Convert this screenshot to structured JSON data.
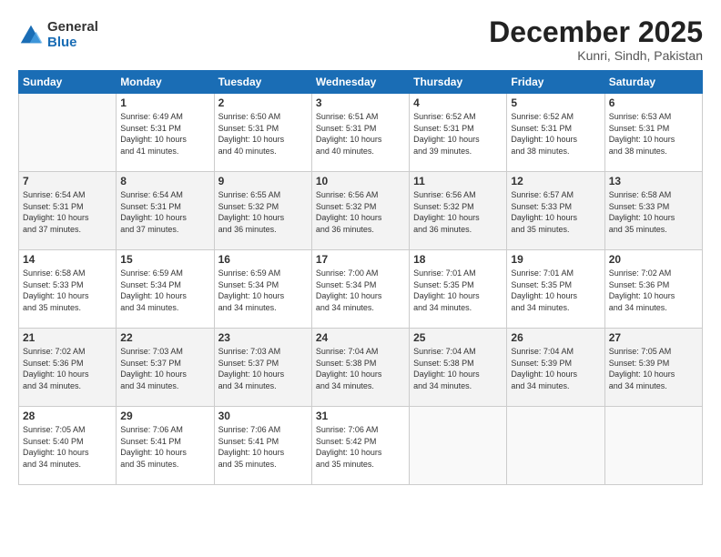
{
  "logo": {
    "general": "General",
    "blue": "Blue"
  },
  "title": "December 2025",
  "subtitle": "Kunri, Sindh, Pakistan",
  "days": [
    "Sunday",
    "Monday",
    "Tuesday",
    "Wednesday",
    "Thursday",
    "Friday",
    "Saturday"
  ],
  "weeks": [
    [
      {
        "day": "",
        "content": ""
      },
      {
        "day": "1",
        "content": "Sunrise: 6:49 AM\nSunset: 5:31 PM\nDaylight: 10 hours\nand 41 minutes."
      },
      {
        "day": "2",
        "content": "Sunrise: 6:50 AM\nSunset: 5:31 PM\nDaylight: 10 hours\nand 40 minutes."
      },
      {
        "day": "3",
        "content": "Sunrise: 6:51 AM\nSunset: 5:31 PM\nDaylight: 10 hours\nand 40 minutes."
      },
      {
        "day": "4",
        "content": "Sunrise: 6:52 AM\nSunset: 5:31 PM\nDaylight: 10 hours\nand 39 minutes."
      },
      {
        "day": "5",
        "content": "Sunrise: 6:52 AM\nSunset: 5:31 PM\nDaylight: 10 hours\nand 38 minutes."
      },
      {
        "day": "6",
        "content": "Sunrise: 6:53 AM\nSunset: 5:31 PM\nDaylight: 10 hours\nand 38 minutes."
      }
    ],
    [
      {
        "day": "7",
        "content": "Sunrise: 6:54 AM\nSunset: 5:31 PM\nDaylight: 10 hours\nand 37 minutes."
      },
      {
        "day": "8",
        "content": "Sunrise: 6:54 AM\nSunset: 5:31 PM\nDaylight: 10 hours\nand 37 minutes."
      },
      {
        "day": "9",
        "content": "Sunrise: 6:55 AM\nSunset: 5:32 PM\nDaylight: 10 hours\nand 36 minutes."
      },
      {
        "day": "10",
        "content": "Sunrise: 6:56 AM\nSunset: 5:32 PM\nDaylight: 10 hours\nand 36 minutes."
      },
      {
        "day": "11",
        "content": "Sunrise: 6:56 AM\nSunset: 5:32 PM\nDaylight: 10 hours\nand 36 minutes."
      },
      {
        "day": "12",
        "content": "Sunrise: 6:57 AM\nSunset: 5:33 PM\nDaylight: 10 hours\nand 35 minutes."
      },
      {
        "day": "13",
        "content": "Sunrise: 6:58 AM\nSunset: 5:33 PM\nDaylight: 10 hours\nand 35 minutes."
      }
    ],
    [
      {
        "day": "14",
        "content": "Sunrise: 6:58 AM\nSunset: 5:33 PM\nDaylight: 10 hours\nand 35 minutes."
      },
      {
        "day": "15",
        "content": "Sunrise: 6:59 AM\nSunset: 5:34 PM\nDaylight: 10 hours\nand 34 minutes."
      },
      {
        "day": "16",
        "content": "Sunrise: 6:59 AM\nSunset: 5:34 PM\nDaylight: 10 hours\nand 34 minutes."
      },
      {
        "day": "17",
        "content": "Sunrise: 7:00 AM\nSunset: 5:34 PM\nDaylight: 10 hours\nand 34 minutes."
      },
      {
        "day": "18",
        "content": "Sunrise: 7:01 AM\nSunset: 5:35 PM\nDaylight: 10 hours\nand 34 minutes."
      },
      {
        "day": "19",
        "content": "Sunrise: 7:01 AM\nSunset: 5:35 PM\nDaylight: 10 hours\nand 34 minutes."
      },
      {
        "day": "20",
        "content": "Sunrise: 7:02 AM\nSunset: 5:36 PM\nDaylight: 10 hours\nand 34 minutes."
      }
    ],
    [
      {
        "day": "21",
        "content": "Sunrise: 7:02 AM\nSunset: 5:36 PM\nDaylight: 10 hours\nand 34 minutes."
      },
      {
        "day": "22",
        "content": "Sunrise: 7:03 AM\nSunset: 5:37 PM\nDaylight: 10 hours\nand 34 minutes."
      },
      {
        "day": "23",
        "content": "Sunrise: 7:03 AM\nSunset: 5:37 PM\nDaylight: 10 hours\nand 34 minutes."
      },
      {
        "day": "24",
        "content": "Sunrise: 7:04 AM\nSunset: 5:38 PM\nDaylight: 10 hours\nand 34 minutes."
      },
      {
        "day": "25",
        "content": "Sunrise: 7:04 AM\nSunset: 5:38 PM\nDaylight: 10 hours\nand 34 minutes."
      },
      {
        "day": "26",
        "content": "Sunrise: 7:04 AM\nSunset: 5:39 PM\nDaylight: 10 hours\nand 34 minutes."
      },
      {
        "day": "27",
        "content": "Sunrise: 7:05 AM\nSunset: 5:39 PM\nDaylight: 10 hours\nand 34 minutes."
      }
    ],
    [
      {
        "day": "28",
        "content": "Sunrise: 7:05 AM\nSunset: 5:40 PM\nDaylight: 10 hours\nand 34 minutes."
      },
      {
        "day": "29",
        "content": "Sunrise: 7:06 AM\nSunset: 5:41 PM\nDaylight: 10 hours\nand 35 minutes."
      },
      {
        "day": "30",
        "content": "Sunrise: 7:06 AM\nSunset: 5:41 PM\nDaylight: 10 hours\nand 35 minutes."
      },
      {
        "day": "31",
        "content": "Sunrise: 7:06 AM\nSunset: 5:42 PM\nDaylight: 10 hours\nand 35 minutes."
      },
      {
        "day": "",
        "content": ""
      },
      {
        "day": "",
        "content": ""
      },
      {
        "day": "",
        "content": ""
      }
    ]
  ]
}
